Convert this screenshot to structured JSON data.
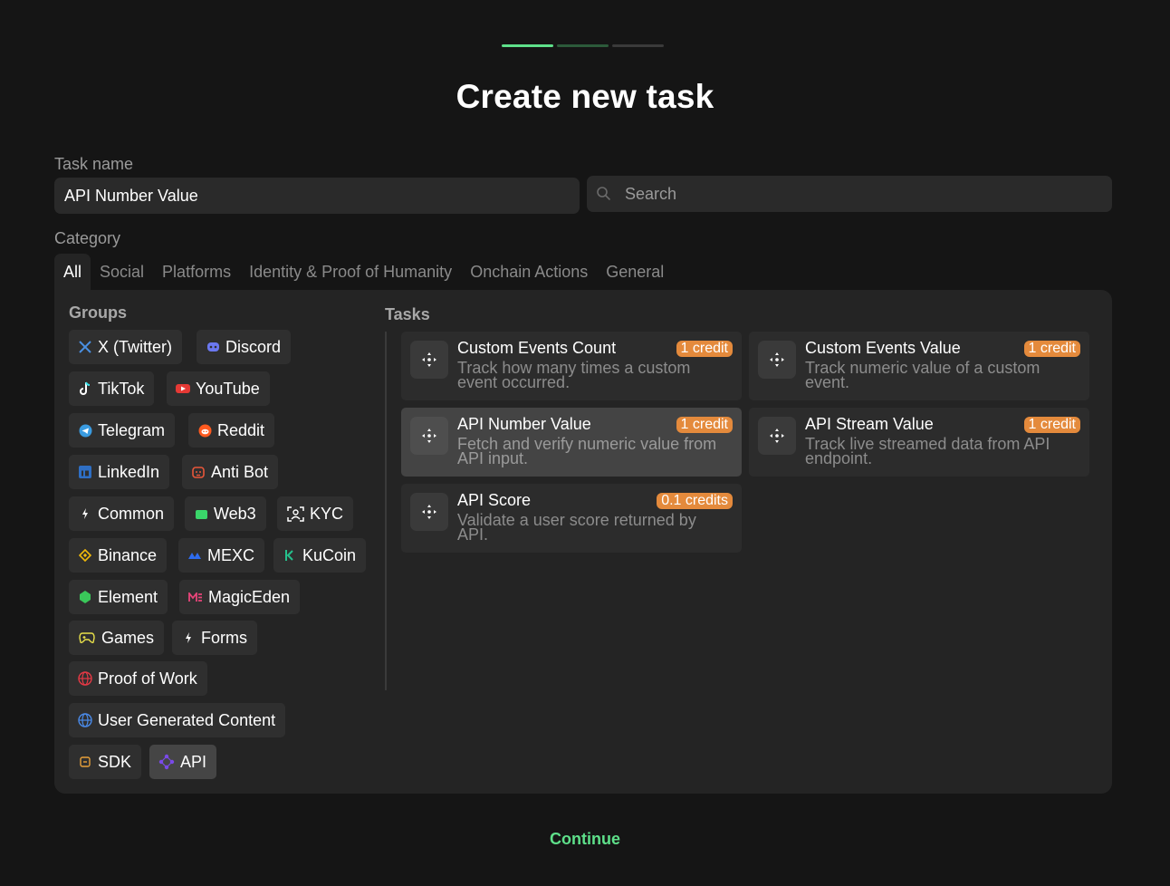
{
  "title": "Create new task",
  "task_name": {
    "label": "Task name",
    "value": "API Number Value"
  },
  "search": {
    "placeholder": "Search"
  },
  "category": {
    "label": "Category",
    "tabs": [
      "All",
      "Social",
      "Platforms",
      "Identity & Proof of Humanity",
      "Onchain Actions",
      "General"
    ],
    "active_tab": "All"
  },
  "groups": {
    "heading": "Groups",
    "items": [
      {
        "label": "X (Twitter)",
        "icon": "x-logo-icon"
      },
      {
        "label": "Discord",
        "icon": "discord-icon"
      },
      {
        "label": "TikTok",
        "icon": "tiktok-icon"
      },
      {
        "label": "YouTube",
        "icon": "youtube-icon"
      },
      {
        "label": "Telegram",
        "icon": "telegram-icon"
      },
      {
        "label": "Reddit",
        "icon": "reddit-icon"
      },
      {
        "label": "LinkedIn",
        "icon": "linkedin-icon"
      },
      {
        "label": "Anti Bot",
        "icon": "robot-icon"
      },
      {
        "label": "Common",
        "icon": "bolt-icon"
      },
      {
        "label": "Web3",
        "icon": "wallet-icon"
      },
      {
        "label": "KYC",
        "icon": "face-scan-icon"
      },
      {
        "label": "Binance",
        "icon": "binance-icon"
      },
      {
        "label": "MEXC",
        "icon": "mexc-icon"
      },
      {
        "label": "KuCoin",
        "icon": "kucoin-icon"
      },
      {
        "label": "Element",
        "icon": "element-icon"
      },
      {
        "label": "MagicEden",
        "icon": "magiceden-icon"
      },
      {
        "label": "Games",
        "icon": "gamepad-icon"
      },
      {
        "label": "Forms",
        "icon": "bolt-icon"
      },
      {
        "label": "Proof of Work",
        "icon": "globe-icon"
      },
      {
        "label": "User Generated Content",
        "icon": "globe-icon"
      },
      {
        "label": "SDK",
        "icon": "sdk-icon"
      },
      {
        "label": "API",
        "icon": "api-icon"
      }
    ],
    "active": "API"
  },
  "tasks": {
    "heading": "Tasks",
    "items": [
      {
        "title": "Custom Events Count",
        "badge": "1 credit",
        "description": "Track how many times a custom event occurred."
      },
      {
        "title": "Custom Events Value",
        "badge": "1 credit",
        "description": "Track numeric value of a custom event."
      },
      {
        "title": "API Number Value",
        "badge": "1 credit",
        "description": "Fetch and verify numeric value from API input."
      },
      {
        "title": "API Stream Value",
        "badge": "1 credit",
        "description": "Track live streamed data from API endpoint."
      },
      {
        "title": "API Score",
        "badge": "0.1 credits",
        "description": "Validate a user score returned by API."
      }
    ],
    "selected": "API Number Value"
  },
  "continue_label": "Continue",
  "colors": {
    "accent": "#5ee08a",
    "badge": "#e48a3c",
    "background": "#151515",
    "panel": "#242424"
  }
}
